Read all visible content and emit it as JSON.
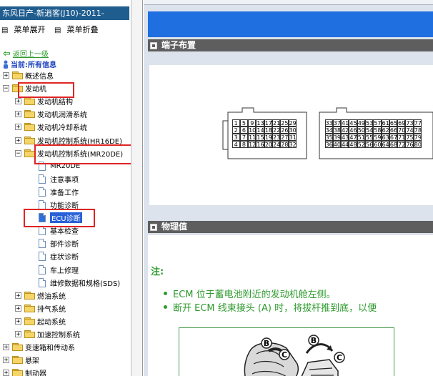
{
  "sidebar": {
    "title": "东风日产-新逍客(J10)-2011-",
    "expand_all": "菜单展开",
    "collapse_all": "菜单折叠",
    "back": "返回上一级",
    "current": "当前:所有信息",
    "tree": [
      {
        "label": "概述信息",
        "level": 0,
        "kind": "folder",
        "expander": "+"
      },
      {
        "label": "发动机",
        "level": 0,
        "kind": "folder",
        "expander": "−"
      },
      {
        "label": "发动机结构",
        "level": 1,
        "kind": "folder",
        "expander": "+"
      },
      {
        "label": "发动机润滑系统",
        "level": 1,
        "kind": "folder",
        "expander": "+"
      },
      {
        "label": "发动机冷却系统",
        "level": 1,
        "kind": "folder",
        "expander": "+"
      },
      {
        "label": "发动机控制系统(HR16DE)",
        "level": 1,
        "kind": "folder",
        "expander": "+"
      },
      {
        "label": "发动机控制系统(MR20DE)",
        "level": 1,
        "kind": "folder",
        "expander": "−"
      },
      {
        "label": "MR20DE",
        "level": 2,
        "kind": "doc"
      },
      {
        "label": "注意事项",
        "level": 2,
        "kind": "doc"
      },
      {
        "label": "准备工作",
        "level": 2,
        "kind": "doc"
      },
      {
        "label": "功能诊断",
        "level": 2,
        "kind": "doc"
      },
      {
        "label": "ECU诊断",
        "level": 2,
        "kind": "doc",
        "selected": true
      },
      {
        "label": "基本检查",
        "level": 2,
        "kind": "doc"
      },
      {
        "label": "部件诊断",
        "level": 2,
        "kind": "doc"
      },
      {
        "label": "症状诊断",
        "level": 2,
        "kind": "doc"
      },
      {
        "label": "车上修理",
        "level": 2,
        "kind": "doc"
      },
      {
        "label": "维修数据和规格(SDS)",
        "level": 2,
        "kind": "doc"
      },
      {
        "label": "燃油系统",
        "level": 1,
        "kind": "folder",
        "expander": "+"
      },
      {
        "label": "排气系统",
        "level": 1,
        "kind": "folder",
        "expander": "+"
      },
      {
        "label": "起动系统",
        "level": 1,
        "kind": "folder",
        "expander": "+"
      },
      {
        "label": "加速控制系统",
        "level": 1,
        "kind": "folder",
        "expander": "+"
      },
      {
        "label": "变速箱和传动系",
        "level": 0,
        "kind": "folder",
        "expander": "+"
      },
      {
        "label": "悬架",
        "level": 0,
        "kind": "folder",
        "expander": "+"
      },
      {
        "label": "制动器",
        "level": 0,
        "kind": "folder",
        "expander": "+"
      }
    ]
  },
  "content": {
    "section1_title": "端子布置",
    "section2_title": "物理值",
    "connector_left": [
      [
        "1",
        "5",
        "9",
        "13",
        "17",
        "21",
        "25",
        "29"
      ],
      [
        "2",
        "6",
        "10",
        "14",
        "18",
        "22",
        "26",
        "30"
      ],
      [
        "3",
        "7",
        "11",
        "15",
        "19",
        "23",
        "27",
        "31"
      ],
      [
        "4",
        "8",
        "12",
        "16",
        "20",
        "24",
        "28",
        "32"
      ]
    ],
    "connector_right": [
      [
        "33",
        "37",
        "41",
        "45",
        "49",
        "53",
        "57",
        "61",
        "65",
        "69",
        "73",
        "77"
      ],
      [
        "34",
        "38",
        "42",
        "46",
        "50",
        "54",
        "58",
        "62",
        "66",
        "70",
        "74",
        "78"
      ],
      [
        "35",
        "39",
        "43",
        "47",
        "51",
        "55",
        "59",
        "63",
        "67",
        "71",
        "75",
        "79"
      ],
      [
        "36",
        "40",
        "44",
        "48",
        "52",
        "56",
        "60",
        "64",
        "68",
        "72",
        "76",
        "80"
      ]
    ],
    "note_title": "注:",
    "notes": [
      "ECM 位于蓄电池附近的发动机舱左侧。",
      "断开 ECM 线束接头 (A) 时，将拔杆推到底，以便"
    ],
    "figure_labels": [
      "B",
      "C",
      "B",
      "C"
    ]
  },
  "colors": {
    "accent": "#1f6fe0",
    "header": "#5e5e5e",
    "note": "#2e9b2e",
    "highlight": "#e02424"
  }
}
